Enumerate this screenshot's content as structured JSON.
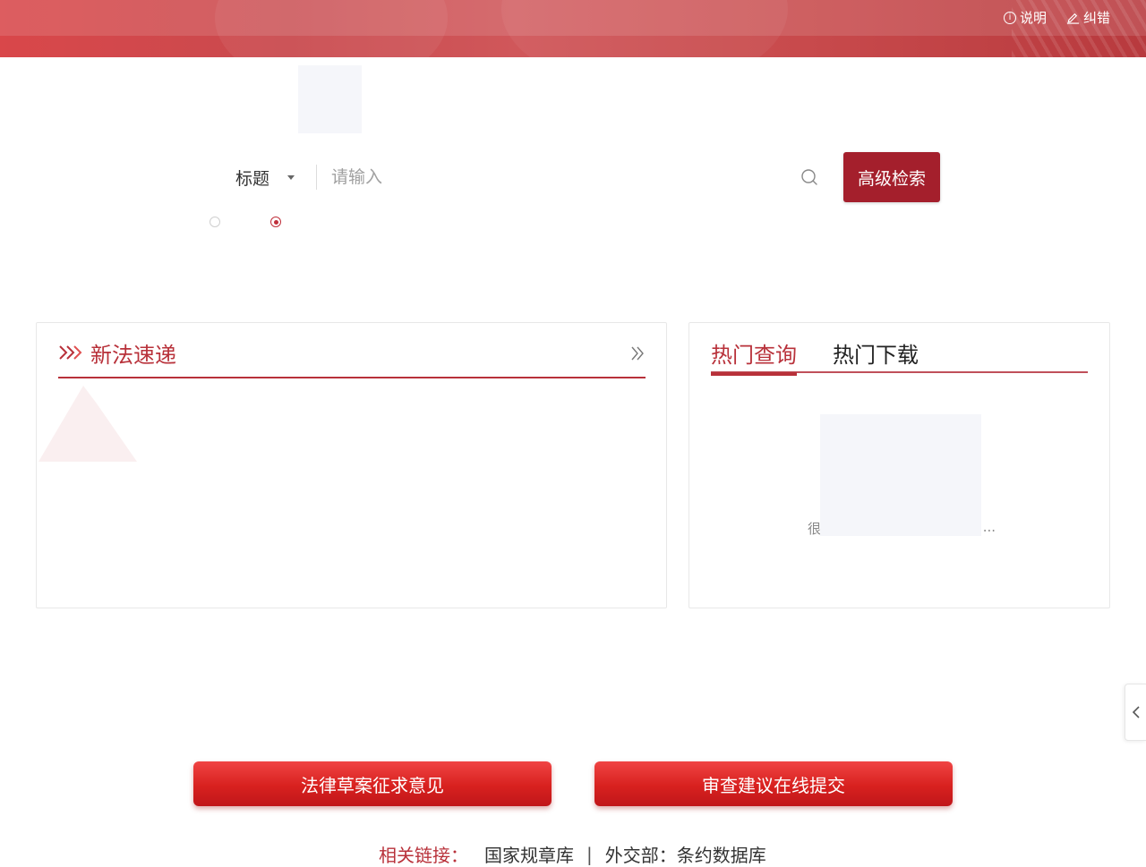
{
  "header": {
    "links": [
      {
        "label": "说明",
        "icon": "info-icon"
      },
      {
        "label": "纠错",
        "icon": "edit-icon"
      }
    ],
    "colors": {
      "banner": "#d9474a",
      "accent": "#a41f2c"
    }
  },
  "search": {
    "field_selected": "标题",
    "placeholder": "请输入",
    "advanced_label": "高级检索",
    "radio_selected_index": 1
  },
  "news_panel": {
    "title": "新法速递"
  },
  "hot_panel": {
    "tabs": [
      {
        "label": "热门查询",
        "active": true
      },
      {
        "label": "热门下载",
        "active": false
      }
    ],
    "empty_text_start": "很",
    "empty_text_end": "..."
  },
  "actions": {
    "draft_label": "法律草案征求意见",
    "review_label": "审查建议在线提交"
  },
  "footer": {
    "related_label": "相关链接：",
    "links": [
      "国家规章库",
      "外交部：条约数据库"
    ],
    "separator": "|"
  }
}
